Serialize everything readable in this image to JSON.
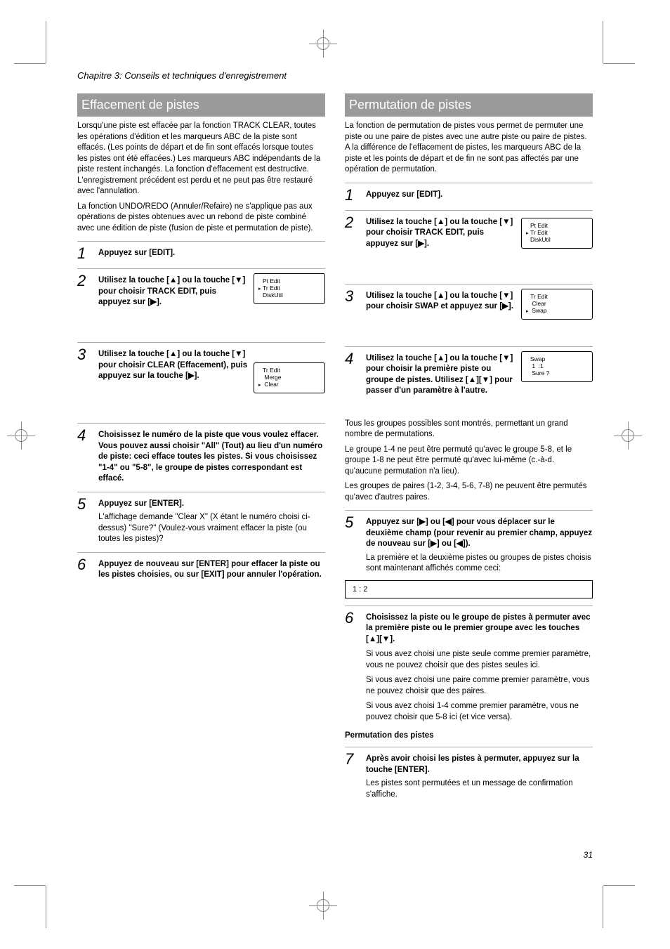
{
  "header": "Chapitre 3: Conseils et techniques d'enregistrement",
  "page_number": "31",
  "left": {
    "section_title": "Effacement de pistes",
    "intro_paragraphs": [
      "Lorsqu'une piste est effacée par la fonction TRACK CLEAR, toutes les opérations d'édition et les marqueurs ABC de la piste sont effacés. (Les points de départ et de fin sont effacés lorsque toutes les pistes ont été effacées.) Les marqueurs ABC indépendants de la piste restent inchangés. La fonction d'effacement est destructive. L'enregistrement précédent est perdu et ne peut pas être restauré avec l'annulation.",
      "La fonction UNDO/REDO (Annuler/Refaire) ne s'applique pas aux opérations de pistes obtenues avec un rebond de piste combiné avec une édition de piste (fusion de piste et permutation de piste)."
    ],
    "steps": [
      {
        "num": "1",
        "text_parts": [
          "Appuyez sur [EDIT]."
        ],
        "extra": ""
      },
      {
        "num": "2",
        "text_parts": [
          "Utilisez la touche [",
          "up",
          "] ou la touche [",
          "down",
          "] pour choisir TRACK EDIT, puis appuyez sur [",
          "right",
          "]."
        ],
        "ui": {
          "lines": [
            "Pt Edit",
            "Tr Edit",
            "DiskUtil"
          ],
          "marker_row": 1
        }
      },
      {
        "num": "3",
        "text_parts": [
          "Utilisez la touche [",
          "up",
          "] ou la touche [",
          "down",
          "] pour choisir CLEAR (Effacement), puis appuyez sur la touche [",
          "right",
          "]."
        ],
        "ui": {
          "lines": [
            "Tr Edit",
            " Merge",
            " Clear"
          ],
          "marker_row": 2
        }
      },
      {
        "num": "4",
        "text_parts": [
          "Choisissez le numéro de la piste que vous voulez effacer. Vous pouvez aussi choisir \"All\" (Tout) au lieu d'un numéro de piste: ceci efface toutes les pistes. Si vous choisissez \"1-4\" ou \"5-8\", le groupe de pistes correspondant est effacé."
        ],
        "extra": ""
      },
      {
        "num": "5",
        "text_parts": [
          "Appuyez sur [ENTER]."
        ],
        "extra": "L'affichage demande \"Clear X\" (X étant le numéro choisi ci-dessus) \"Sure?\" (Voulez-vous vraiment effacer la piste (ou toutes les pistes)?"
      },
      {
        "num": "6",
        "text_parts": [
          "Appuyez de nouveau sur [ENTER] pour effacer la piste ou les pistes choisies, ou sur [EXIT] pour annuler l'opération."
        ],
        "extra": ""
      }
    ]
  },
  "right": {
    "section_title": "Permutation de pistes",
    "intro": "La fonction de permutation de pistes vous permet de permuter une piste ou une paire de pistes avec une autre piste ou paire de pistes. A la différence de l'effacement de pistes, les marqueurs ABC de la piste et les points de départ et de fin ne sont pas affectés par une opération de permutation.",
    "steps": [
      {
        "num": "1",
        "text_parts": [
          "Appuyez sur [EDIT]."
        ]
      },
      {
        "num": "2",
        "text_parts": [
          "Utilisez la touche [",
          "up",
          "] ou la touche [",
          "down",
          "] pour choisir TRACK EDIT, puis appuyez sur [",
          "right",
          "]."
        ],
        "ui": {
          "lines": [
            "Pt Edit",
            "Tr Edit",
            "DiskUtil"
          ],
          "marker_row": 1
        }
      },
      {
        "num": "3",
        "text_parts": [
          "Utilisez la touche [",
          "up",
          "] ou la touche [",
          "down",
          "] pour choisir SWAP et appuyez sur [",
          "right",
          "]."
        ],
        "ui": {
          "lines": [
            "Tr Edit",
            " Clear",
            " Swap"
          ],
          "marker_row": 2
        }
      },
      {
        "num": "4",
        "text_parts": [
          "Utilisez la touche [",
          "up",
          "] ou la touche [",
          "down",
          "] pour choisir la première piste ou groupe de pistes. Utilisez [",
          "up",
          "][",
          "down",
          "] pour passer d'un paramètre à l'autre."
        ],
        "ui": {
          "lines": [
            "Swap",
            " 1  :1",
            " Sure ?"
          ],
          "marker_row": -1
        }
      }
    ],
    "after_step4": [
      "Tous les groupes possibles sont montrés, permettant un grand nombre de permutations.",
      "Le groupe 1-4 ne peut être permuté qu'avec le groupe 5-8, et le groupe 1-8 ne peut être permuté qu'avec lui-même (c.-à-d. qu'aucune permutation n'a lieu).",
      "Les groupes de paires (1-2, 3-4, 5-6, 7-8) ne peuvent être permutés qu'avec d'autres paires."
    ],
    "step5": {
      "num": "5",
      "text_parts_a": [
        "Appuyez sur [",
        "right",
        "] ou [",
        "left",
        "] pour vous déplacer sur le deuxième champ (pour revenir au premier champ, appuyez de nouveau sur [",
        "right",
        "] ou [",
        "left",
        "])."
      ],
      "text_after": "La première et la deuxième pistes ou groupes de pistes choisis sont maintenant affichés comme ceci:"
    },
    "param_box": "1   :    2",
    "step6": {
      "num": "6",
      "text_parts": [
        "Choisissez la piste ou le groupe de pistes à permuter avec la première piste ou le premier groupe avec les touches [",
        "up",
        "][",
        "down",
        "]."
      ],
      "after": [
        "Si vous avez choisi une piste seule comme premier paramètre, vous ne pouvez choisir que des pistes seules ici.",
        "Si vous avez choisi une paire comme premier paramètre, vous ne pouvez choisir que des paires.",
        "Si vous avez choisi 1-4 comme premier paramètre, vous ne pouvez choisir que 5-8 ici (et vice versa)."
      ]
    },
    "subhead": "Permutation des pistes",
    "step7": {
      "num": "7",
      "text_parts": [
        "Après avoir choisi les pistes à permuter, appuyez sur la touche [ENTER]."
      ],
      "after": "Les pistes sont permutées et un message de confirmation s'affiche."
    }
  },
  "glyphs": {
    "up": "▲",
    "down": "▼",
    "left": "◀",
    "right": "▶",
    "small_right": "▸"
  }
}
